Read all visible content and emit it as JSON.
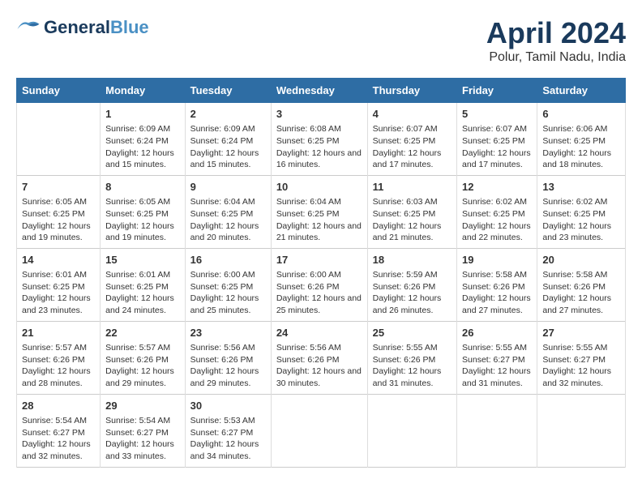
{
  "header": {
    "logo_general": "General",
    "logo_blue": "Blue",
    "month_title": "April 2024",
    "location": "Polur, Tamil Nadu, India"
  },
  "columns": [
    "Sunday",
    "Monday",
    "Tuesday",
    "Wednesday",
    "Thursday",
    "Friday",
    "Saturday"
  ],
  "weeks": [
    [
      {
        "day": "",
        "sunrise": "",
        "sunset": "",
        "daylight": ""
      },
      {
        "day": "1",
        "sunrise": "Sunrise: 6:09 AM",
        "sunset": "Sunset: 6:24 PM",
        "daylight": "Daylight: 12 hours and 15 minutes."
      },
      {
        "day": "2",
        "sunrise": "Sunrise: 6:09 AM",
        "sunset": "Sunset: 6:24 PM",
        "daylight": "Daylight: 12 hours and 15 minutes."
      },
      {
        "day": "3",
        "sunrise": "Sunrise: 6:08 AM",
        "sunset": "Sunset: 6:25 PM",
        "daylight": "Daylight: 12 hours and 16 minutes."
      },
      {
        "day": "4",
        "sunrise": "Sunrise: 6:07 AM",
        "sunset": "Sunset: 6:25 PM",
        "daylight": "Daylight: 12 hours and 17 minutes."
      },
      {
        "day": "5",
        "sunrise": "Sunrise: 6:07 AM",
        "sunset": "Sunset: 6:25 PM",
        "daylight": "Daylight: 12 hours and 17 minutes."
      },
      {
        "day": "6",
        "sunrise": "Sunrise: 6:06 AM",
        "sunset": "Sunset: 6:25 PM",
        "daylight": "Daylight: 12 hours and 18 minutes."
      }
    ],
    [
      {
        "day": "7",
        "sunrise": "Sunrise: 6:05 AM",
        "sunset": "Sunset: 6:25 PM",
        "daylight": "Daylight: 12 hours and 19 minutes."
      },
      {
        "day": "8",
        "sunrise": "Sunrise: 6:05 AM",
        "sunset": "Sunset: 6:25 PM",
        "daylight": "Daylight: 12 hours and 19 minutes."
      },
      {
        "day": "9",
        "sunrise": "Sunrise: 6:04 AM",
        "sunset": "Sunset: 6:25 PM",
        "daylight": "Daylight: 12 hours and 20 minutes."
      },
      {
        "day": "10",
        "sunrise": "Sunrise: 6:04 AM",
        "sunset": "Sunset: 6:25 PM",
        "daylight": "Daylight: 12 hours and 21 minutes."
      },
      {
        "day": "11",
        "sunrise": "Sunrise: 6:03 AM",
        "sunset": "Sunset: 6:25 PM",
        "daylight": "Daylight: 12 hours and 21 minutes."
      },
      {
        "day": "12",
        "sunrise": "Sunrise: 6:02 AM",
        "sunset": "Sunset: 6:25 PM",
        "daylight": "Daylight: 12 hours and 22 minutes."
      },
      {
        "day": "13",
        "sunrise": "Sunrise: 6:02 AM",
        "sunset": "Sunset: 6:25 PM",
        "daylight": "Daylight: 12 hours and 23 minutes."
      }
    ],
    [
      {
        "day": "14",
        "sunrise": "Sunrise: 6:01 AM",
        "sunset": "Sunset: 6:25 PM",
        "daylight": "Daylight: 12 hours and 23 minutes."
      },
      {
        "day": "15",
        "sunrise": "Sunrise: 6:01 AM",
        "sunset": "Sunset: 6:25 PM",
        "daylight": "Daylight: 12 hours and 24 minutes."
      },
      {
        "day": "16",
        "sunrise": "Sunrise: 6:00 AM",
        "sunset": "Sunset: 6:25 PM",
        "daylight": "Daylight: 12 hours and 25 minutes."
      },
      {
        "day": "17",
        "sunrise": "Sunrise: 6:00 AM",
        "sunset": "Sunset: 6:26 PM",
        "daylight": "Daylight: 12 hours and 25 minutes."
      },
      {
        "day": "18",
        "sunrise": "Sunrise: 5:59 AM",
        "sunset": "Sunset: 6:26 PM",
        "daylight": "Daylight: 12 hours and 26 minutes."
      },
      {
        "day": "19",
        "sunrise": "Sunrise: 5:58 AM",
        "sunset": "Sunset: 6:26 PM",
        "daylight": "Daylight: 12 hours and 27 minutes."
      },
      {
        "day": "20",
        "sunrise": "Sunrise: 5:58 AM",
        "sunset": "Sunset: 6:26 PM",
        "daylight": "Daylight: 12 hours and 27 minutes."
      }
    ],
    [
      {
        "day": "21",
        "sunrise": "Sunrise: 5:57 AM",
        "sunset": "Sunset: 6:26 PM",
        "daylight": "Daylight: 12 hours and 28 minutes."
      },
      {
        "day": "22",
        "sunrise": "Sunrise: 5:57 AM",
        "sunset": "Sunset: 6:26 PM",
        "daylight": "Daylight: 12 hours and 29 minutes."
      },
      {
        "day": "23",
        "sunrise": "Sunrise: 5:56 AM",
        "sunset": "Sunset: 6:26 PM",
        "daylight": "Daylight: 12 hours and 29 minutes."
      },
      {
        "day": "24",
        "sunrise": "Sunrise: 5:56 AM",
        "sunset": "Sunset: 6:26 PM",
        "daylight": "Daylight: 12 hours and 30 minutes."
      },
      {
        "day": "25",
        "sunrise": "Sunrise: 5:55 AM",
        "sunset": "Sunset: 6:26 PM",
        "daylight": "Daylight: 12 hours and 31 minutes."
      },
      {
        "day": "26",
        "sunrise": "Sunrise: 5:55 AM",
        "sunset": "Sunset: 6:27 PM",
        "daylight": "Daylight: 12 hours and 31 minutes."
      },
      {
        "day": "27",
        "sunrise": "Sunrise: 5:55 AM",
        "sunset": "Sunset: 6:27 PM",
        "daylight": "Daylight: 12 hours and 32 minutes."
      }
    ],
    [
      {
        "day": "28",
        "sunrise": "Sunrise: 5:54 AM",
        "sunset": "Sunset: 6:27 PM",
        "daylight": "Daylight: 12 hours and 32 minutes."
      },
      {
        "day": "29",
        "sunrise": "Sunrise: 5:54 AM",
        "sunset": "Sunset: 6:27 PM",
        "daylight": "Daylight: 12 hours and 33 minutes."
      },
      {
        "day": "30",
        "sunrise": "Sunrise: 5:53 AM",
        "sunset": "Sunset: 6:27 PM",
        "daylight": "Daylight: 12 hours and 34 minutes."
      },
      {
        "day": "",
        "sunrise": "",
        "sunset": "",
        "daylight": ""
      },
      {
        "day": "",
        "sunrise": "",
        "sunset": "",
        "daylight": ""
      },
      {
        "day": "",
        "sunrise": "",
        "sunset": "",
        "daylight": ""
      },
      {
        "day": "",
        "sunrise": "",
        "sunset": "",
        "daylight": ""
      }
    ]
  ]
}
